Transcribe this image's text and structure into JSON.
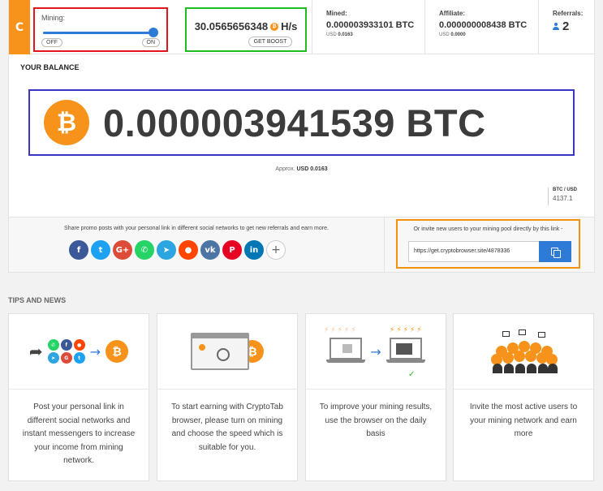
{
  "logo": {
    "glyph": "C"
  },
  "mining": {
    "label": "Mining:",
    "off_label": "OFF",
    "on_label": "ON",
    "level_fraction": 1.0
  },
  "speed": {
    "value": "30.0565656348",
    "unit": "H/s",
    "boost_label": "GET BOOST"
  },
  "stats": {
    "mined": {
      "label": "Mined:",
      "value": "0.000003933101 BTC",
      "usd_prefix": "USD",
      "usd_value": "0.0163"
    },
    "affiliate": {
      "label": "Affiliate:",
      "value": "0.000000008438 BTC",
      "usd_prefix": "USD",
      "usd_value": "0.0000"
    },
    "referrals": {
      "label": "Referrals:",
      "value": "2"
    }
  },
  "balance": {
    "title": "YOUR BALANCE",
    "value": "0.000003941539 BTC",
    "approx_prefix": "Approx.",
    "approx_value": "USD 0.0163",
    "rate_label": "BTC / USD",
    "rate_value": "4137.1"
  },
  "share": {
    "text": "Share promo posts with your personal link in different social networks to get new referrals and earn more.",
    "socials": [
      {
        "name": "facebook",
        "glyph": "f",
        "color": "#3b5998"
      },
      {
        "name": "twitter",
        "glyph": "t",
        "color": "#1da1f2"
      },
      {
        "name": "google-plus",
        "glyph": "G+",
        "color": "#dd4b39"
      },
      {
        "name": "whatsapp",
        "glyph": "✆",
        "color": "#25d366"
      },
      {
        "name": "telegram",
        "glyph": "➤",
        "color": "#2ca5e0"
      },
      {
        "name": "reddit",
        "glyph": "●",
        "color": "#ff4500"
      },
      {
        "name": "vk",
        "glyph": "vk",
        "color": "#4c75a3"
      },
      {
        "name": "pinterest",
        "glyph": "P",
        "color": "#e60023"
      },
      {
        "name": "linkedin",
        "glyph": "in",
        "color": "#0077b5"
      },
      {
        "name": "more",
        "glyph": "+",
        "color": "#ffffff"
      }
    ],
    "invite_text": "Or invite new users to your mining pool directly by this link -",
    "invite_link": "https://get.cryptobrowser.site/4878336",
    "copy_icon": "copy-icon"
  },
  "tips": {
    "title": "TIPS AND NEWS",
    "items": [
      {
        "text": "Post your personal link in different social networks and instant messengers to increase your income from mining network."
      },
      {
        "text": "To start earning with CryptoTab browser, please turn on mining and choose the speed which is suitable for you."
      },
      {
        "text": "To improve your mining results, use the browser on the daily basis"
      },
      {
        "text": "Invite the most active users to your mining network and earn more"
      }
    ]
  },
  "colors": {
    "brand_orange": "#f7931a",
    "accent_blue": "#2d7bd6",
    "highlight_red": "#e3161c",
    "highlight_green": "#1fbd22",
    "highlight_purple": "#3b35c4",
    "highlight_orange": "#f3920f"
  }
}
